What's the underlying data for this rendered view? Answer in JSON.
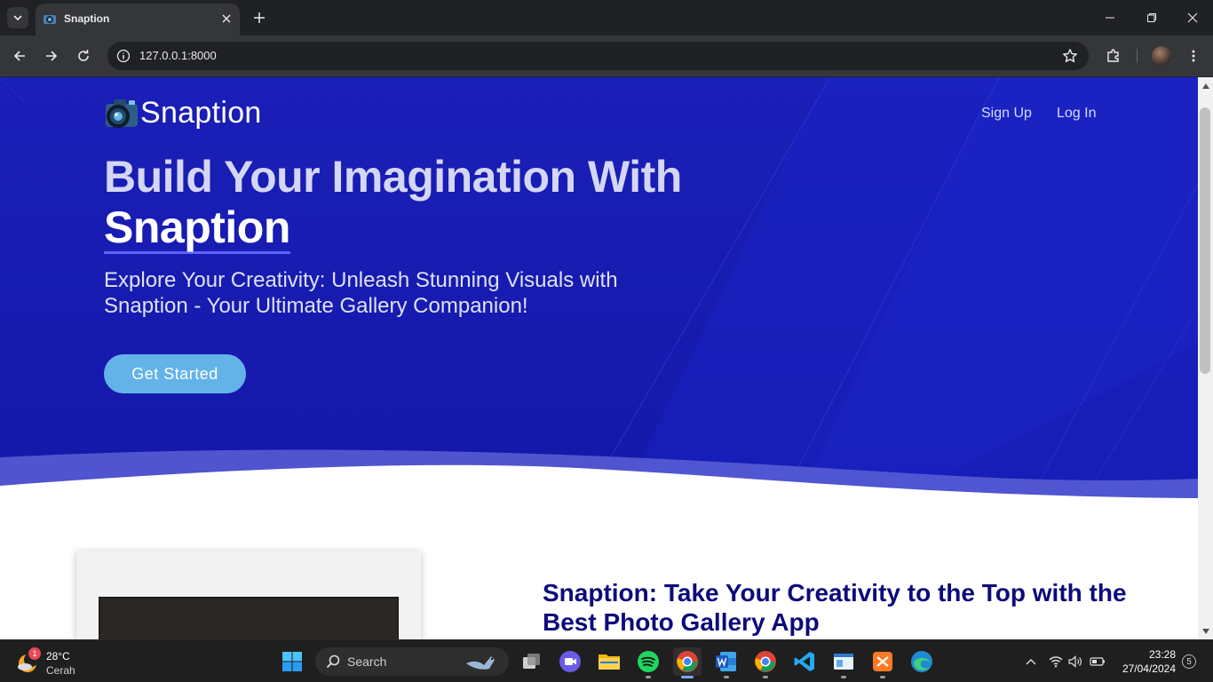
{
  "browser": {
    "tab_title": "Snaption",
    "url": "127.0.0.1:8000"
  },
  "site": {
    "brand": "Snaption",
    "nav": {
      "signup": "Sign Up",
      "login": "Log In"
    },
    "hero": {
      "headline_line1": "Build Your Imagination With",
      "headline_line2": "Snaption",
      "subtitle": "Explore Your Creativity: Unleash Stunning Visuals with Snaption - Your Ultimate Gallery Companion!",
      "cta": "Get Started"
    },
    "section_title": "Snaption: Take Your Creativity to the Top with the Best Photo Gallery App"
  },
  "taskbar": {
    "weather": {
      "temp": "28°C",
      "condition": "Cerah",
      "badge": "1"
    },
    "search_label": "Search",
    "time": "23:28",
    "date": "27/04/2024",
    "notifications": "5"
  },
  "colors": {
    "hero_bg": "#1a1fb8",
    "cta_bg": "#63b3e8",
    "section_title": "#0d0a7a",
    "underline": "#5b63ff"
  }
}
